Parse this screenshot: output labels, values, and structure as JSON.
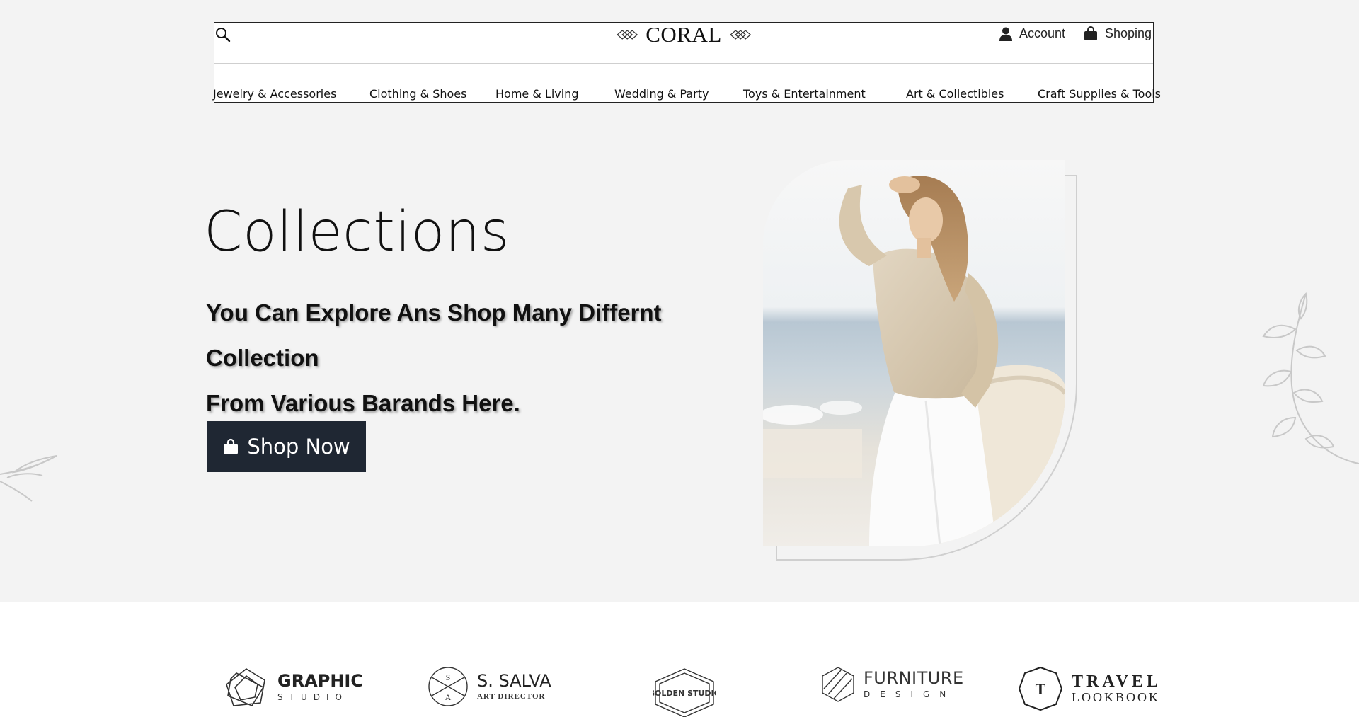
{
  "header": {
    "logo_text": "CORAL",
    "account_label": "Account",
    "shopping_label": "Shoping"
  },
  "nav": {
    "items": [
      {
        "label": "Jewelry & Accessories"
      },
      {
        "label": "Clothing & Shoes"
      },
      {
        "label": "Home & Living"
      },
      {
        "label": "Wedding & Party"
      },
      {
        "label": "Toys & Entertainment"
      },
      {
        "label": "Art & Collectibles"
      },
      {
        "label": "Craft Supplies & Tools"
      }
    ]
  },
  "hero": {
    "title": "Collections",
    "subtitle_line1": "You Can Explore Ans Shop Many Differnt Collection",
    "subtitle_line2": "From Various Barands Here.",
    "button_label": "Shop Now"
  },
  "brands": [
    {
      "name": "GRAPHIC",
      "sub": "STUDIO"
    },
    {
      "name": "S. SALVA",
      "sub": "ART DIRECTOR",
      "monogram_top": "S",
      "monogram_bottom": "A"
    },
    {
      "name": "GOLDEN STUDIO"
    },
    {
      "name": "FURNITURE",
      "sub": "DESIGN"
    },
    {
      "name": "TRAVEL",
      "sub": "LOOKBOOK",
      "monogram": "T"
    }
  ],
  "colors": {
    "hero_bg": "#f3f3f3",
    "button_bg": "#1f2733",
    "text": "#111111"
  }
}
